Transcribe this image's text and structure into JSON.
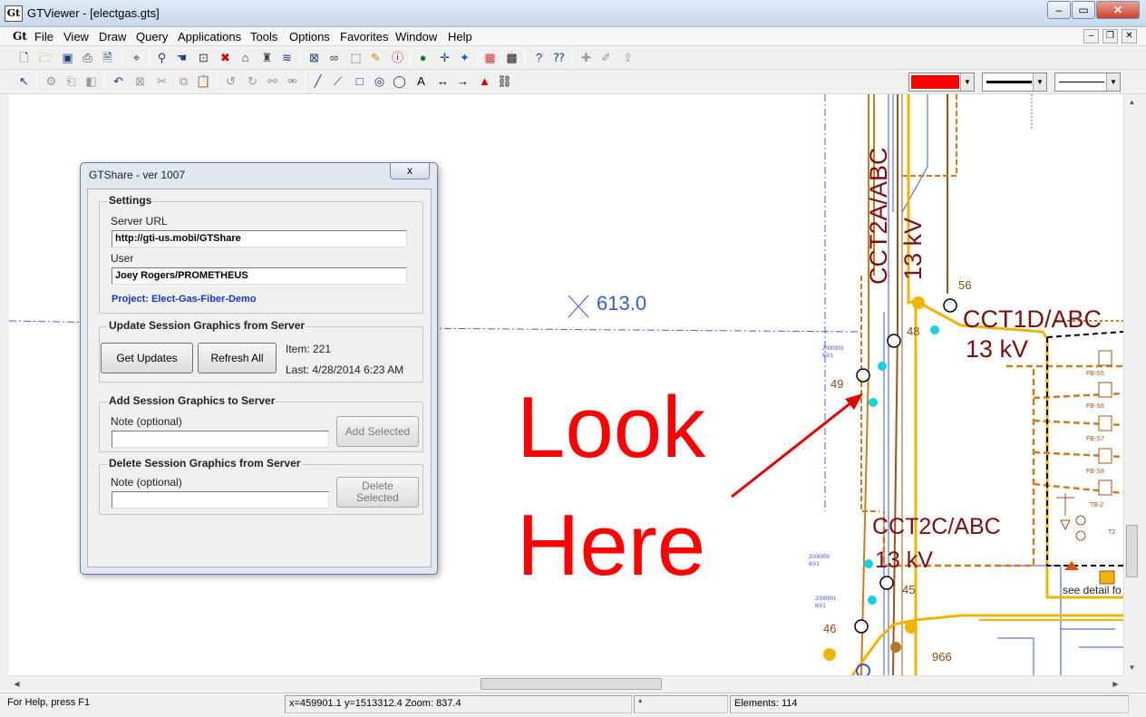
{
  "window": {
    "title": "GTViewer - [electgas.gts]",
    "app_icon": "Gt",
    "minimize": "–",
    "maximize": "▭",
    "close": "✕"
  },
  "menu": {
    "items": [
      "File",
      "View",
      "Draw",
      "Query",
      "Applications",
      "Tools",
      "Options",
      "Favorites",
      "Window",
      "Help"
    ],
    "mdi_minimize": "–",
    "mdi_restore": "❐",
    "mdi_close": "✕"
  },
  "toolbar": {
    "color_swatch": "#ff0000"
  },
  "map": {
    "elevation_label": "613.0",
    "circuit_labels": [
      "CCT2A/ABC",
      "13 kV",
      "CCT1D/ABC",
      "13 kV",
      "CCT2C/ABC",
      "13 kV"
    ],
    "node_numbers": [
      "56",
      "48",
      "49",
      "45",
      "46",
      "966"
    ],
    "callout_line1": "Look",
    "callout_line2": "Here",
    "side_labels": [
      "FB-S5",
      "FB-S6",
      "FB-S7",
      "FB-S8",
      "TB-2",
      "T2",
      "see detail fo"
    ],
    "small_labels": [
      "2000903",
      "60/1",
      "2000900",
      "60/1",
      "2000901",
      "60/1"
    ]
  },
  "dialog": {
    "title": "GTShare - ver 1007",
    "close_label": "x",
    "settings": {
      "group_title": "Settings",
      "server_url_label": "Server URL",
      "server_url_value": "http://gti-us.mobi/GTShare",
      "user_label": "User",
      "user_value": "Joey Rogers/PROMETHEUS",
      "project_text": "Project: Elect-Gas-Fiber-Demo"
    },
    "update": {
      "group_title": "Update Session Graphics from Server",
      "get_updates_label": "Get Updates",
      "refresh_all_label": "Refresh All",
      "item_text": "Item: 221",
      "last_text": "Last: 4/28/2014 6:23 AM"
    },
    "add": {
      "group_title": "Add Session Graphics to Server",
      "note_label": "Note (optional)",
      "note_value": "",
      "add_selected_label": "Add Selected"
    },
    "delete": {
      "group_title": "Delete Session Graphics from Server",
      "note_label": "Note (optional)",
      "note_value": "",
      "delete_selected_line1": "Delete",
      "delete_selected_line2": "Selected"
    }
  },
  "status": {
    "help_text": "For Help, press F1",
    "coords_text": "x=459901.1 y=1513312.4  Zoom: 837.4",
    "modified_text": "*",
    "elements_text": "Elements: 114"
  }
}
